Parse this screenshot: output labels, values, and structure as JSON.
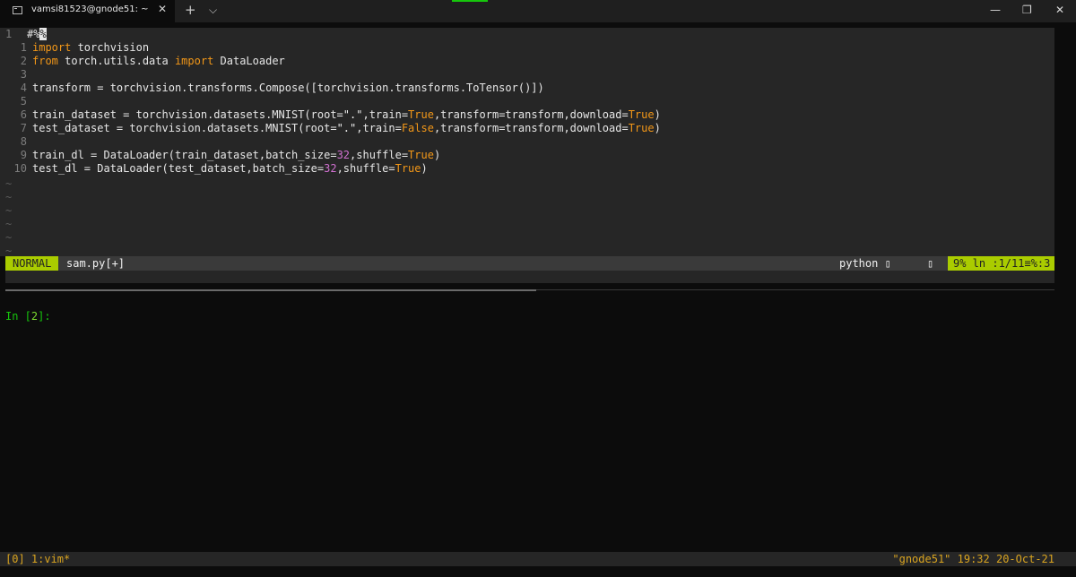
{
  "tabbar": {
    "tab_title": "vamsi81523@gnode51: ~",
    "tab_close": "✕",
    "new_tab": "+",
    "dropdown": "⌵",
    "minimize": "—",
    "maximize": "❐",
    "close": "✕"
  },
  "editor": {
    "cursor_line_number": "1",
    "line1": {
      "pre": "#%",
      "cursor": "%"
    },
    "line2": {
      "num": "1",
      "kw1": "import",
      "rest": " torchvision"
    },
    "line3": {
      "num": "2",
      "kw1": "from",
      "mid": " torch.utils.data ",
      "kw2": "import",
      "rest": " DataLoader"
    },
    "line4": {
      "num": "3"
    },
    "line5": {
      "num": "4",
      "text": "transform = torchvision.transforms.Compose([torchvision.transforms.ToTensor()])"
    },
    "line6": {
      "num": "5"
    },
    "line7": {
      "num": "6",
      "a": "train_dataset = torchvision.datasets.MNIST(root=",
      "s": "\".\"",
      "b": ",train=",
      "v1": "True",
      "c": ",transform=transform,download=",
      "v2": "True",
      "d": ")"
    },
    "line8": {
      "num": "7",
      "a": "test_dataset = torchvision.datasets.MNIST(root=",
      "s": "\".\"",
      "b": ",train=",
      "v1": "False",
      "c": ",transform=transform,download=",
      "v2": "True",
      "d": ")"
    },
    "line9": {
      "num": "8"
    },
    "line10": {
      "num": "9",
      "a": "train_dl = DataLoader(train_dataset,batch_size=",
      "n": "32",
      "b": ",shuffle=",
      "v": "True",
      "c": ")"
    },
    "line11": {
      "num": "10",
      "a": "test_dl = DataLoader(test_dataset,batch_size=",
      "n": "32",
      "b": ",shuffle=",
      "v": "True",
      "c": ")"
    },
    "tilde": "~"
  },
  "statusline": {
    "mode": "NORMAL",
    "filename": "sam.py[+]",
    "filetype": "python ",
    "filetype_icon": "▯",
    "sep_icon": "▯",
    "position": "9%  ln :1/11≡%:3"
  },
  "repl": {
    "prompt_pre": "In [",
    "prompt_num": "2",
    "prompt_post": "]:"
  },
  "tmux": {
    "left": "[0] 1:vim*",
    "right": "\"gnode51\" 19:32 20-Oct-21"
  },
  "colors": {
    "mode_bg": "#aacc00",
    "keyword": "#f29718",
    "number": "#d070d0",
    "prompt": "#16c60c",
    "tmux_text": "#d9a420"
  }
}
